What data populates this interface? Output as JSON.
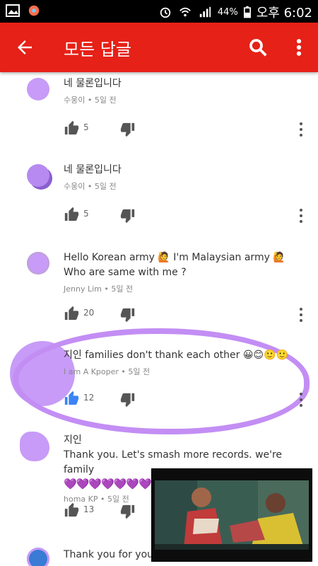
{
  "status_bar": {
    "battery": "44%",
    "time": "오후 6:02"
  },
  "app_bar": {
    "title": "모든 답글"
  },
  "comments": [
    {
      "text": "네 물론입니다",
      "author": "수웅이",
      "time": "5일 전",
      "likes": "5"
    },
    {
      "text": "네 물론입니다",
      "author": "수웅이",
      "time": "5일 전",
      "likes": "5"
    },
    {
      "text": "Hello Korean army 🙋 I'm Malaysian army 🙋  Who are same with me ?",
      "author": "Jenny Lim",
      "time": "5일 전",
      "likes": "20"
    },
    {
      "text": "지인 families don't thank each other 😀😊🙂🙂",
      "author": "I am A Kpoper",
      "time": "5일 전",
      "likes": "12"
    },
    {
      "text_line1": "지인",
      "text_line2": "Thank you. Let's smash more records. we're family",
      "hearts": "💜💜💜💜💜💜💜",
      "author": "homa KP",
      "time": "5일 전",
      "likes": "13"
    },
    {
      "text": "Thank you for your"
    }
  ],
  "separator": "•",
  "icons": {
    "back": "arrow-left-icon",
    "search": "search-icon",
    "more": "more-vertical-icon",
    "like": "thumb-up-icon",
    "dislike": "thumb-down-icon",
    "kebab": "kebab-icon"
  },
  "colors": {
    "app_bar": "#e62117",
    "highlight": "#c38ef4",
    "like_active": "#3b83f7"
  }
}
